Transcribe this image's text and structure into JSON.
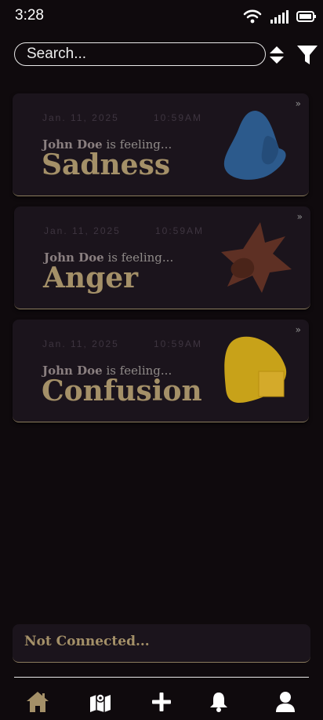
{
  "status": {
    "time": "3:28"
  },
  "search": {
    "placeholder": "Search..."
  },
  "cards": [
    {
      "date": "Jan. 11, 2025",
      "time": "10:59AM",
      "user": "John Doe",
      "feeling_text": "is feeling...",
      "emotion": "Sadness",
      "color": "#2c5a8c"
    },
    {
      "date": "Jan. 11, 2025",
      "time": "10:59AM",
      "user": "John Doe",
      "feeling_text": "is feeling...",
      "emotion": "Anger",
      "color": "#5e3024"
    },
    {
      "date": "Jan. 11, 2025",
      "time": "10:59AM",
      "user": "John Doe",
      "feeling_text": "is feeling...",
      "emotion": "Confusion",
      "color": "#c8a219"
    }
  ],
  "card_chevron": "»",
  "connection": {
    "status": "Not Connected..."
  },
  "nav": [
    {
      "icon": "home-icon",
      "color": "#a49068"
    },
    {
      "icon": "map-icon",
      "color": "#ffffff"
    },
    {
      "icon": "plus-icon",
      "color": "#ffffff"
    },
    {
      "icon": "bell-icon",
      "color": "#ffffff"
    },
    {
      "icon": "profile-icon",
      "color": "#ffffff"
    }
  ]
}
